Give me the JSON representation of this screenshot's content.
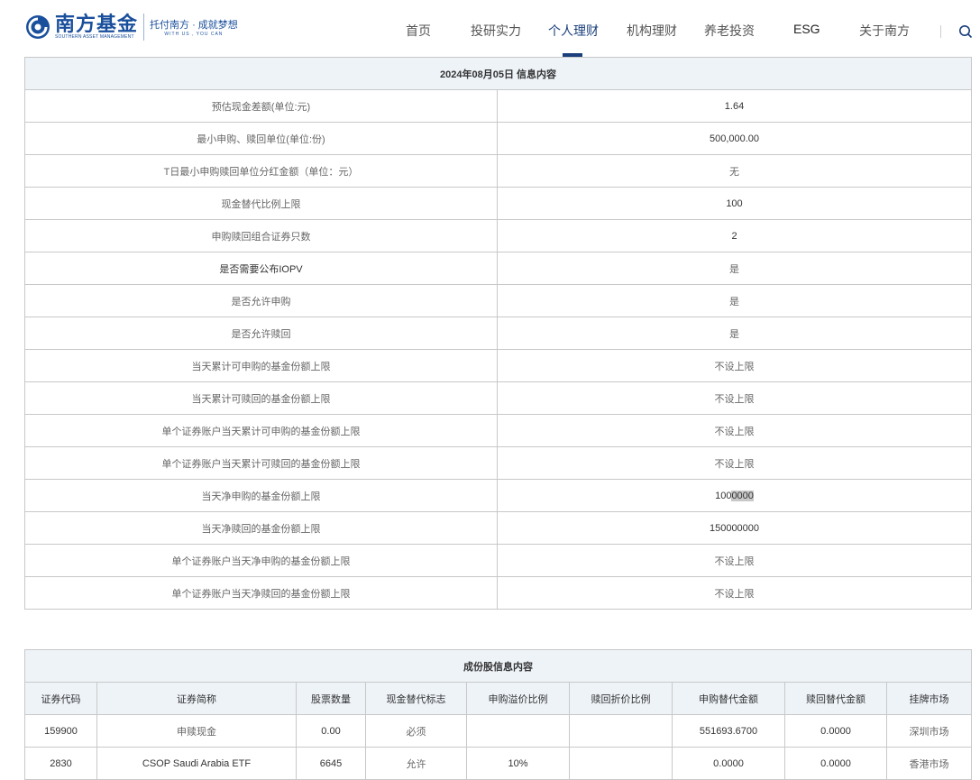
{
  "brand": {
    "name_cn": "南方基金",
    "name_en": "SOUTHERN ASSET MANAGEMENT",
    "slogan_cn": "托付南方 · 成就梦想",
    "slogan_en": "WITH US , YOU CAN"
  },
  "nav": [
    "首页",
    "投研实力",
    "个人理财",
    "机构理财",
    "养老投资",
    "ESG",
    "关于南方"
  ],
  "info_table": {
    "title": "2024年08月05日 信息内容",
    "rows": [
      [
        "预估现金差额(单位:元)",
        "1.64"
      ],
      [
        "最小申购、赎回单位(单位:份)",
        "500,000.00"
      ],
      [
        "T日最小申购赎回单位分红金额（单位：元）",
        "无"
      ],
      [
        "现金替代比例上限",
        "100"
      ],
      [
        "申购赎回组合证券只数",
        "2"
      ],
      [
        "是否需要公布IOPV",
        "是"
      ],
      [
        "是否允许申购",
        "是"
      ],
      [
        "是否允许赎回",
        "是"
      ],
      [
        "当天累计可申购的基金份额上限",
        "不设上限"
      ],
      [
        "当天累计可赎回的基金份额上限",
        "不设上限"
      ],
      [
        "单个证券账户当天累计可申购的基金份额上限",
        "不设上限"
      ],
      [
        "单个证券账户当天累计可赎回的基金份额上限",
        "不设上限"
      ],
      [
        "当天净申购的基金份额上限",
        "1000000"
      ],
      [
        "当天净赎回的基金份额上限",
        "150000000"
      ],
      [
        "单个证券账户当天净申购的基金份额上限",
        "不设上限"
      ],
      [
        "单个证券账户当天净赎回的基金份额上限",
        "不设上限"
      ]
    ],
    "selected_part": {
      "prefix": "100",
      "selected": "0000"
    }
  },
  "component_table": {
    "title": "成份股信息内容",
    "headers": [
      "证券代码",
      "证券简称",
      "股票数量",
      "现金替代标志",
      "申购溢价比例",
      "赎回折价比例",
      "申购替代金额",
      "赎回替代金额",
      "挂牌市场"
    ],
    "rows": [
      [
        "159900",
        "申赎现金",
        "0.00",
        "必须",
        "",
        "",
        "551693.6700",
        "0.0000",
        "深圳市场"
      ],
      [
        "2830",
        "CSOP Saudi Arabia ETF",
        "6645",
        "允许",
        "10%",
        "",
        "0.0000",
        "0.0000",
        "香港市场"
      ]
    ]
  }
}
